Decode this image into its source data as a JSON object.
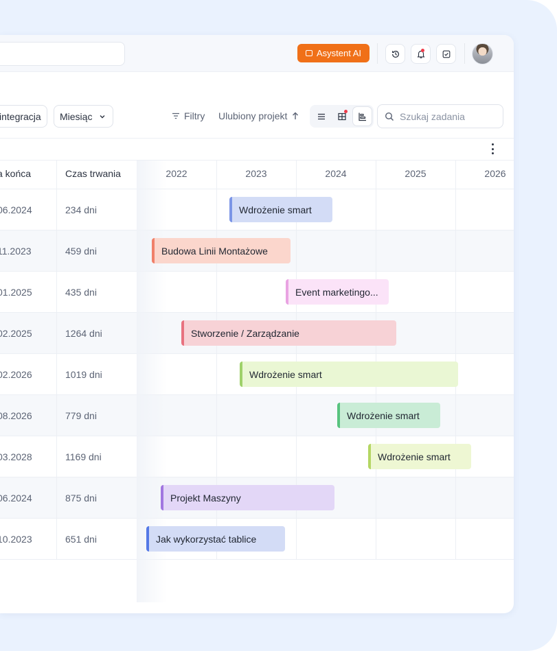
{
  "header": {
    "ai_button_label": "Asystent AI"
  },
  "toolbar": {
    "integration_chip": "integracja",
    "period_select": "Miesiąc",
    "filters_label": "Filtry",
    "sort_label": "Ulubiony projekt",
    "search_placeholder": "Szukaj zadania"
  },
  "table": {
    "columns": [
      "a końca",
      "Czas trwania"
    ],
    "years": [
      "2022",
      "2023",
      "2024",
      "2025",
      "2026"
    ],
    "rows": [
      {
        "end": "06.2024",
        "duration": "234 dni",
        "task": "Wdrożenie smart"
      },
      {
        "end": "11.2023",
        "duration": "459 dni",
        "task": "Budowa Linii Montażowe"
      },
      {
        "end": "01.2025",
        "duration": "435 dni",
        "task": "Event marketingo..."
      },
      {
        "end": "02.2025",
        "duration": "1264 dni",
        "task": "Stworzenie / Zarządzanie"
      },
      {
        "end": "02.2026",
        "duration": "1019 dni",
        "task": "Wdrożenie smart"
      },
      {
        "end": "08.2026",
        "duration": "779 dni",
        "task": "Wdrożenie smart"
      },
      {
        "end": "03.2028",
        "duration": "1169 dni",
        "task": "Wdrożenie smart"
      },
      {
        "end": "06.2024",
        "duration": "875 dni",
        "task": "Projekt Maszyny"
      },
      {
        "end": "10.2023",
        "duration": "651 dni",
        "task": "Jak wykorzystać tablice"
      }
    ]
  },
  "colors": {
    "ai_button": "#f07018",
    "bars": [
      {
        "fill": "#d3dcf6",
        "accent": "#7b95e6"
      },
      {
        "fill": "#fbd6cc",
        "accent": "#f0806a"
      },
      {
        "fill": "#fbe3f8",
        "accent": "#e9a3e2"
      },
      {
        "fill": "#f7d2d6",
        "accent": "#e8727f"
      },
      {
        "fill": "#eaf7d4",
        "accent": "#9ed16a"
      },
      {
        "fill": "#c9ecd6",
        "accent": "#58c37f"
      },
      {
        "fill": "#eef7d3",
        "accent": "#b4d663"
      },
      {
        "fill": "#e3d7f7",
        "accent": "#a176e0"
      },
      {
        "fill": "#d3dcf6",
        "accent": "#5579e6"
      }
    ]
  }
}
